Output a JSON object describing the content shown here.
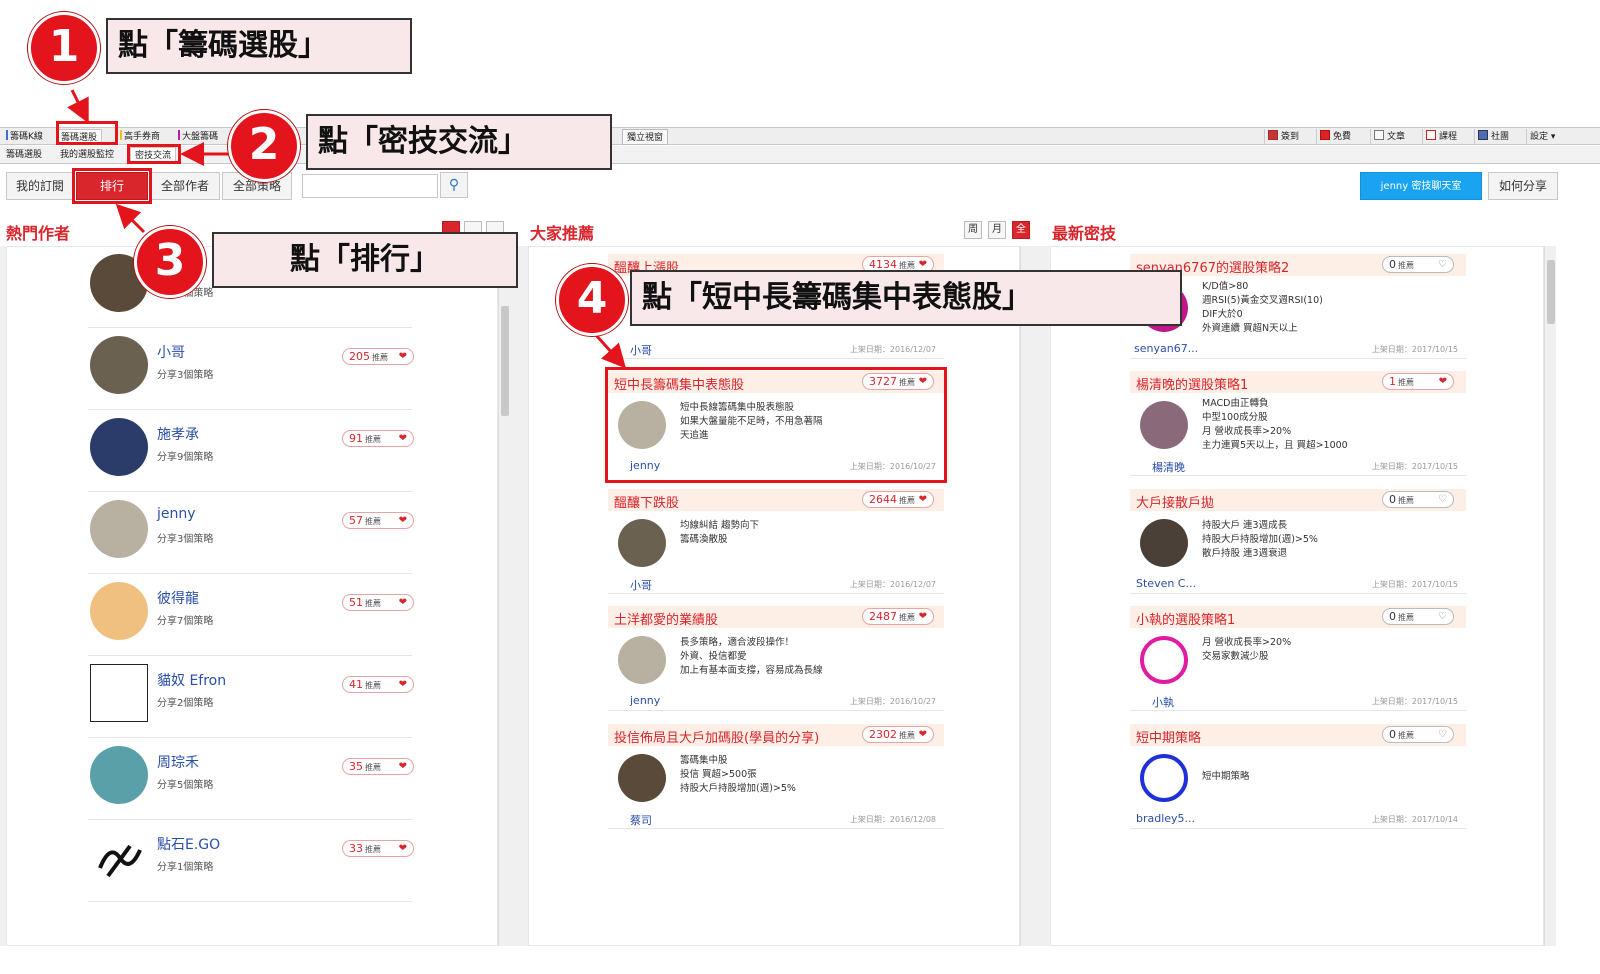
{
  "annotations": [
    {
      "num": "1",
      "text": "點「籌碼選股」"
    },
    {
      "num": "2",
      "text": "點「密技交流」"
    },
    {
      "num": "3",
      "text": "點「排行」"
    },
    {
      "num": "4",
      "text": "點「短中長籌碼集中表態股」"
    }
  ],
  "tabs_top": [
    "籌碼K線",
    "籌碼選股",
    "高手券商",
    "大盤籌碼",
    "獨立視窗"
  ],
  "tabs_sub": [
    "籌碼選股",
    "我的選股監控",
    "密技交流"
  ],
  "right_tools": [
    "簽到",
    "免費",
    "文章",
    "課程",
    "社團",
    "設定"
  ],
  "toolbar": {
    "my_sub": "我的訂閱",
    "rank": "排行",
    "all_authors": "全部作者",
    "all_strategies": "全部策略",
    "search_placeholder": "",
    "chat": "jenny 密技聊天室",
    "how_share": "如何分享"
  },
  "sections": {
    "hot_authors": "熱門作者",
    "recommended": "大家推薦",
    "latest": "最新密技"
  },
  "period_filters": [
    "周",
    "月",
    "全"
  ],
  "recommend_label": "推薦",
  "authors": [
    {
      "name": "",
      "shares": "分享4個策略",
      "count": ""
    },
    {
      "name": "小哥",
      "shares": "分享3個策略",
      "count": "205"
    },
    {
      "name": "施孝承",
      "shares": "分享9個策略",
      "count": "91"
    },
    {
      "name": "jenny",
      "shares": "分享3個策略",
      "count": "57"
    },
    {
      "name": "彼得龍",
      "shares": "分享7個策略",
      "count": "51"
    },
    {
      "name": "貓奴 Efron",
      "shares": "分享2個策略",
      "count": "41"
    },
    {
      "name": "周琮禾",
      "shares": "分享5個策略",
      "count": "35"
    },
    {
      "name": "點石E.GO",
      "shares": "分享1個策略",
      "count": "33"
    }
  ],
  "recommended_cards": [
    {
      "title": "醞釀上漲股",
      "count": "4134",
      "desc": "",
      "author": "小哥",
      "date": "上架日期：2016/12/07"
    },
    {
      "title": "短中長籌碼集中表態股",
      "count": "3727",
      "desc": "短中長線籌碼集中股表態股\n如果大盤量能不足時，不用急著隔\n天追進",
      "author": "jenny",
      "date": "上架日期：2016/10/27"
    },
    {
      "title": "醞釀下跌股",
      "count": "2644",
      "desc": "均線糾結 趨勢向下\n籌碼渙散股",
      "author": "小哥",
      "date": "上架日期：2016/12/07"
    },
    {
      "title": "土洋都愛的業績股",
      "count": "2487",
      "desc": "長多策略，適合波段操作！\n外資、投信都愛\n加上有基本面支撐，容易成為長線",
      "author": "jenny",
      "date": "上架日期：2016/10/27"
    },
    {
      "title": "投信佈局且大戶加碼股(學員的分享)",
      "count": "2302",
      "desc": "籌碼集中股\n投信 買超>500張\n持股大戶持股增加(週)>5%",
      "author": "蔡司",
      "date": "上架日期：2016/12/08"
    }
  ],
  "latest_cards": [
    {
      "title": "senyan6767的選股策略2",
      "count": "0",
      "desc": "K/D值>80\n週RSI(5)黃金交叉週RSI(10)\nDIF大於0\n外資連續 買超N天以上",
      "author": "senyan67...",
      "date": "上架日期：2017/10/15"
    },
    {
      "title": "楊清晚的選股策略1",
      "count": "1",
      "desc": "MACD由正轉負\n中型100成分股\n月 營收成長率>20%\n主力連買5天以上，且 買超>1000",
      "author": "楊清晚",
      "date": "上架日期：2017/10/15"
    },
    {
      "title": "大戶接散戶拋",
      "count": "0",
      "desc": "持股大戶 連3週成長\n持股大戶持股增加(週)>5%\n散戶持股 連3週衰退",
      "author": "Steven C...",
      "date": "上架日期：2017/10/15"
    },
    {
      "title": "小執的選股策略1",
      "count": "0",
      "desc": "月 營收成長率>20%\n交易家數減少股",
      "author": "小執",
      "date": "上架日期：2017/10/15"
    },
    {
      "title": "短中期策略",
      "count": "0",
      "desc": "短中期策略",
      "author": "bradley5...",
      "date": "上架日期：2017/10/14"
    }
  ],
  "colors": {
    "accent": "#d9262c",
    "link": "#2a4fa8",
    "chat": "#1aa3f0",
    "annot": "#e3141b"
  }
}
